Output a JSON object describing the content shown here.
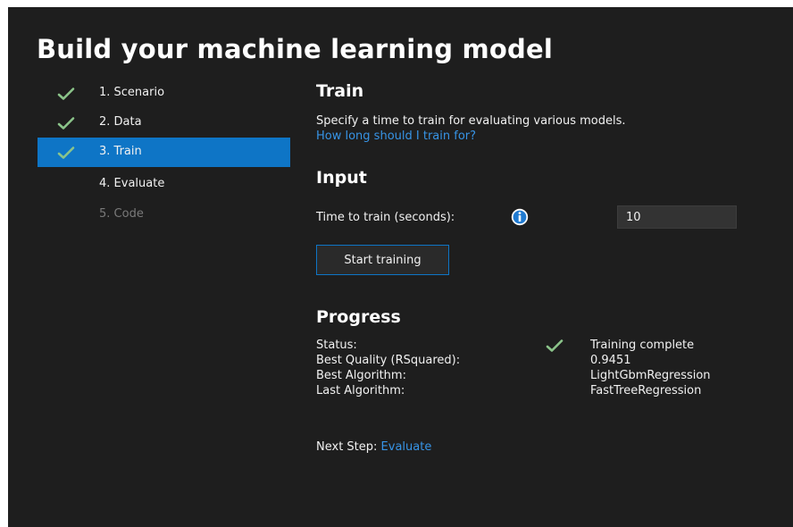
{
  "title": "Build your machine learning model",
  "sidebar": {
    "items": [
      {
        "label": "1. Scenario",
        "completed": true,
        "active": false,
        "enabled": true
      },
      {
        "label": "2. Data",
        "completed": true,
        "active": false,
        "enabled": true
      },
      {
        "label": "3. Train",
        "completed": true,
        "active": true,
        "enabled": true
      },
      {
        "label": "4. Evaluate",
        "completed": false,
        "active": false,
        "enabled": true
      },
      {
        "label": "5. Code",
        "completed": false,
        "active": false,
        "enabled": false
      }
    ]
  },
  "train": {
    "heading": "Train",
    "description": "Specify a time to train for evaluating various models.",
    "help_link": "How long should I train for?"
  },
  "input": {
    "heading": "Input",
    "time_label": "Time to train (seconds):",
    "time_value": "10",
    "info_icon": "info-icon",
    "start_button": "Start training"
  },
  "progress": {
    "heading": "Progress",
    "status_label": "Status:",
    "status_value": "Training complete",
    "status_icon": "check-icon",
    "best_quality_label": "Best Quality (RSquared):",
    "best_quality_value": "0.9451",
    "best_algorithm_label": "Best Algorithm:",
    "best_algorithm_value": "LightGbmRegression",
    "last_algorithm_label": "Last Algorithm:",
    "last_algorithm_value": "FastTreeRegression"
  },
  "next_step": {
    "label": "Next Step:",
    "link": "Evaluate"
  },
  "colors": {
    "background": "#1e1e1e",
    "accent": "#0e75c6",
    "link": "#3794e6",
    "check": "#8bc48a",
    "disabled_text": "#7a7a7a"
  }
}
